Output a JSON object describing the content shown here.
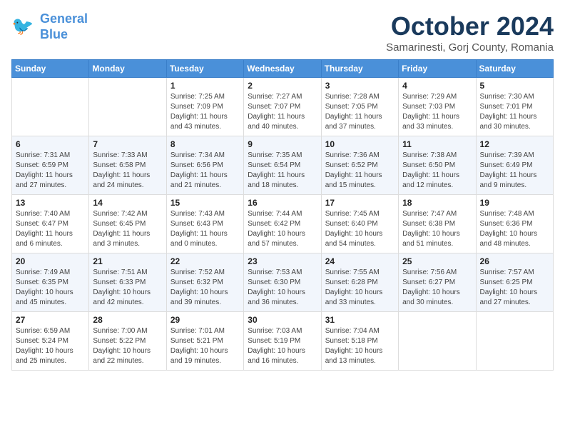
{
  "header": {
    "logo_line1": "General",
    "logo_line2": "Blue",
    "month": "October 2024",
    "location": "Samarinesti, Gorj County, Romania"
  },
  "weekdays": [
    "Sunday",
    "Monday",
    "Tuesday",
    "Wednesday",
    "Thursday",
    "Friday",
    "Saturday"
  ],
  "weeks": [
    [
      {
        "day": "",
        "content": ""
      },
      {
        "day": "",
        "content": ""
      },
      {
        "day": "1",
        "content": "Sunrise: 7:25 AM\nSunset: 7:09 PM\nDaylight: 11 hours and 43 minutes."
      },
      {
        "day": "2",
        "content": "Sunrise: 7:27 AM\nSunset: 7:07 PM\nDaylight: 11 hours and 40 minutes."
      },
      {
        "day": "3",
        "content": "Sunrise: 7:28 AM\nSunset: 7:05 PM\nDaylight: 11 hours and 37 minutes."
      },
      {
        "day": "4",
        "content": "Sunrise: 7:29 AM\nSunset: 7:03 PM\nDaylight: 11 hours and 33 minutes."
      },
      {
        "day": "5",
        "content": "Sunrise: 7:30 AM\nSunset: 7:01 PM\nDaylight: 11 hours and 30 minutes."
      }
    ],
    [
      {
        "day": "6",
        "content": "Sunrise: 7:31 AM\nSunset: 6:59 PM\nDaylight: 11 hours and 27 minutes."
      },
      {
        "day": "7",
        "content": "Sunrise: 7:33 AM\nSunset: 6:58 PM\nDaylight: 11 hours and 24 minutes."
      },
      {
        "day": "8",
        "content": "Sunrise: 7:34 AM\nSunset: 6:56 PM\nDaylight: 11 hours and 21 minutes."
      },
      {
        "day": "9",
        "content": "Sunrise: 7:35 AM\nSunset: 6:54 PM\nDaylight: 11 hours and 18 minutes."
      },
      {
        "day": "10",
        "content": "Sunrise: 7:36 AM\nSunset: 6:52 PM\nDaylight: 11 hours and 15 minutes."
      },
      {
        "day": "11",
        "content": "Sunrise: 7:38 AM\nSunset: 6:50 PM\nDaylight: 11 hours and 12 minutes."
      },
      {
        "day": "12",
        "content": "Sunrise: 7:39 AM\nSunset: 6:49 PM\nDaylight: 11 hours and 9 minutes."
      }
    ],
    [
      {
        "day": "13",
        "content": "Sunrise: 7:40 AM\nSunset: 6:47 PM\nDaylight: 11 hours and 6 minutes."
      },
      {
        "day": "14",
        "content": "Sunrise: 7:42 AM\nSunset: 6:45 PM\nDaylight: 11 hours and 3 minutes."
      },
      {
        "day": "15",
        "content": "Sunrise: 7:43 AM\nSunset: 6:43 PM\nDaylight: 11 hours and 0 minutes."
      },
      {
        "day": "16",
        "content": "Sunrise: 7:44 AM\nSunset: 6:42 PM\nDaylight: 10 hours and 57 minutes."
      },
      {
        "day": "17",
        "content": "Sunrise: 7:45 AM\nSunset: 6:40 PM\nDaylight: 10 hours and 54 minutes."
      },
      {
        "day": "18",
        "content": "Sunrise: 7:47 AM\nSunset: 6:38 PM\nDaylight: 10 hours and 51 minutes."
      },
      {
        "day": "19",
        "content": "Sunrise: 7:48 AM\nSunset: 6:36 PM\nDaylight: 10 hours and 48 minutes."
      }
    ],
    [
      {
        "day": "20",
        "content": "Sunrise: 7:49 AM\nSunset: 6:35 PM\nDaylight: 10 hours and 45 minutes."
      },
      {
        "day": "21",
        "content": "Sunrise: 7:51 AM\nSunset: 6:33 PM\nDaylight: 10 hours and 42 minutes."
      },
      {
        "day": "22",
        "content": "Sunrise: 7:52 AM\nSunset: 6:32 PM\nDaylight: 10 hours and 39 minutes."
      },
      {
        "day": "23",
        "content": "Sunrise: 7:53 AM\nSunset: 6:30 PM\nDaylight: 10 hours and 36 minutes."
      },
      {
        "day": "24",
        "content": "Sunrise: 7:55 AM\nSunset: 6:28 PM\nDaylight: 10 hours and 33 minutes."
      },
      {
        "day": "25",
        "content": "Sunrise: 7:56 AM\nSunset: 6:27 PM\nDaylight: 10 hours and 30 minutes."
      },
      {
        "day": "26",
        "content": "Sunrise: 7:57 AM\nSunset: 6:25 PM\nDaylight: 10 hours and 27 minutes."
      }
    ],
    [
      {
        "day": "27",
        "content": "Sunrise: 6:59 AM\nSunset: 5:24 PM\nDaylight: 10 hours and 25 minutes."
      },
      {
        "day": "28",
        "content": "Sunrise: 7:00 AM\nSunset: 5:22 PM\nDaylight: 10 hours and 22 minutes."
      },
      {
        "day": "29",
        "content": "Sunrise: 7:01 AM\nSunset: 5:21 PM\nDaylight: 10 hours and 19 minutes."
      },
      {
        "day": "30",
        "content": "Sunrise: 7:03 AM\nSunset: 5:19 PM\nDaylight: 10 hours and 16 minutes."
      },
      {
        "day": "31",
        "content": "Sunrise: 7:04 AM\nSunset: 5:18 PM\nDaylight: 10 hours and 13 minutes."
      },
      {
        "day": "",
        "content": ""
      },
      {
        "day": "",
        "content": ""
      }
    ]
  ]
}
